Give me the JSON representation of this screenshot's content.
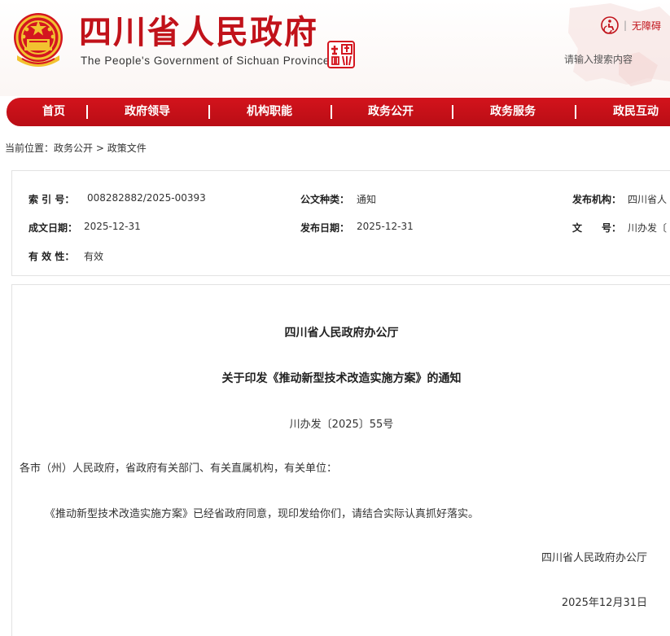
{
  "header": {
    "site_title": "四川省人民政府",
    "site_subtitle": "The People's Government of Sichuan Province",
    "emblem_icon": "national-emblem-icon",
    "seal_text": "中国 四川",
    "accessibility_label": "无障碍",
    "search_placeholder": "请输入搜索内容",
    "brand_color": "#c1121a"
  },
  "nav": {
    "items": [
      {
        "label": "首页"
      },
      {
        "label": "政府领导"
      },
      {
        "label": "机构职能"
      },
      {
        "label": "政务公开"
      },
      {
        "label": "政务服务"
      },
      {
        "label": "政民互动"
      }
    ],
    "background": "#c8101a"
  },
  "breadcrumb": {
    "prefix": "当前位置：",
    "items": [
      "政务公开",
      "政策文件"
    ],
    "separator": " > "
  },
  "meta": {
    "index_label": "索 引 号：",
    "index_value": "008282882/2025-00393",
    "category_label": "公文种类：",
    "category_value": "通知",
    "org_label": "发布机构：",
    "org_value": "四川省人",
    "created_label": "成文日期：",
    "created_value": "2025-12-31",
    "published_label": "发布日期：",
    "published_value": "2025-12-31",
    "docno_label": "文　　号：",
    "docno_value": "川办发〔",
    "validity_label": "有 效 性：",
    "validity_value": "有效"
  },
  "document": {
    "issuer": "四川省人民政府办公厅",
    "title": "关于印发《推动新型技术改造实施方案》的通知",
    "number": "川办发〔2025〕55号",
    "salutation": "各市（州）人民政府，省政府有关部门、有关直属机构，有关单位：",
    "body": "《推动新型技术改造实施方案》已经省政府同意，现印发给你们，请结合实际认真抓好落实。",
    "signature": "四川省人民政府办公厅",
    "date": "2025年12月31日"
  }
}
